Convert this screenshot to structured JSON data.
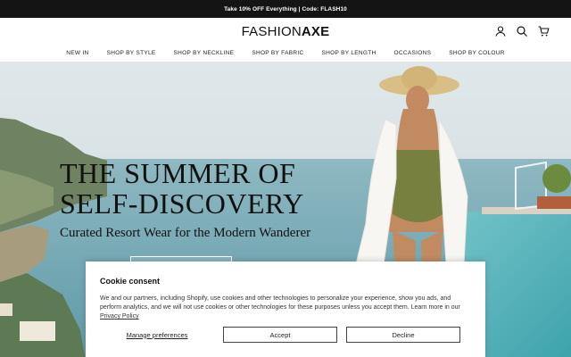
{
  "announcement": "Take 10% OFF Everything | Code: FLASH10",
  "brand": {
    "part1": "FASHION",
    "part2": "AXE"
  },
  "nav": [
    "NEW IN",
    "SHOP BY STYLE",
    "SHOP BY NECKLINE",
    "SHOP BY FABRIC",
    "SHOP BY LENGTH",
    "OCCASIONS",
    "SHOP BY COLOUR"
  ],
  "hero": {
    "title_line1": "THE SUMMER OF",
    "title_line2": "SELF-DISCOVERY",
    "subtitle": "Curated Resort Wear for the Modern Wanderer"
  },
  "cookie": {
    "title": "Cookie consent",
    "body": "We and our partners, including Shopify, use cookies and other technologies to personalize your experience, show you ads, and perform analytics, and we will not use cookies or other technologies for these purposes unless you accept them. Learn more in our ",
    "link": "Privacy Policy",
    "manage": "Manage preferences",
    "accept": "Accept",
    "decline": "Decline"
  },
  "icons": [
    "account-icon",
    "search-icon",
    "cart-icon"
  ]
}
